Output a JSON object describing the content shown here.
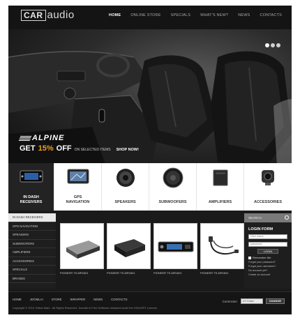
{
  "logo": {
    "boxed": "CAR",
    "rest": "audio"
  },
  "nav": [
    "HOME",
    "ONLINE STORE",
    "SPECIALS",
    "WHAT'S NEW?",
    "NEWS",
    "CONTACTS"
  ],
  "hero": {
    "brand": "ALPINE",
    "get": "GET",
    "percent": "15%",
    "off": "OFF",
    "small": "ON SELECTED ITEMS",
    "shop": "SHOP NOW!",
    "slides_active": 1
  },
  "categories": [
    {
      "label_line1": "IN DASH",
      "label_line2": "RECEIVERS",
      "icon": "in-dash-receiver-icon"
    },
    {
      "label_line1": "GPS",
      "label_line2": "NAVIGATION",
      "icon": "gps-navigation-icon"
    },
    {
      "label_line1": "SPEAKERS",
      "label_line2": "",
      "icon": "speaker-icon"
    },
    {
      "label_line1": "SUBWOOFERS",
      "label_line2": "",
      "icon": "subwoofer-icon"
    },
    {
      "label_line1": "AMPLIFIERS",
      "label_line2": "",
      "icon": "amplifier-icon"
    },
    {
      "label_line1": "ACCESSORIES",
      "label_line2": "",
      "icon": "accessory-icon"
    }
  ],
  "sidebar": [
    "IN DASH RECEIVERS",
    "GPS NAVIGATION",
    "SPEAKERS",
    "SUBWOOFERS",
    "AMPLIFIERS",
    "ACCESSORIES",
    "SPECIALS",
    "BRANDS"
  ],
  "products": [
    {
      "name": "PIONEER TS-MR1601"
    },
    {
      "name": "PIONEER TS-MR1601"
    },
    {
      "name": "PIONEER TS-MR1601"
    },
    {
      "name": "PIONEER TS-MR1601"
    }
  ],
  "search": {
    "label": "SEARCH"
  },
  "login": {
    "title": "LOGIN FORM",
    "username_placeholder": "User name",
    "password_placeholder": "password",
    "button": "LOGIN",
    "remember": "Remember Me",
    "forgot_password": "Forgot your password?",
    "forgot_username": "Forgot your username?",
    "register_line1": "No account yet?",
    "register_line2": "Create an account"
  },
  "footer": {
    "nav": [
      "HOME",
      "JOOMLA!",
      "STORE",
      "WRAPPER",
      "NEWS",
      "CONTACTS"
    ],
    "copyright": "Copyright © 2012 Yellow Mark . All Rights Reserved. Joomla! is Free Software released under the GNU/GPL License.",
    "currency_label": "Currencies:",
    "currency_value": "US Dollar",
    "change": "CHANGE"
  }
}
